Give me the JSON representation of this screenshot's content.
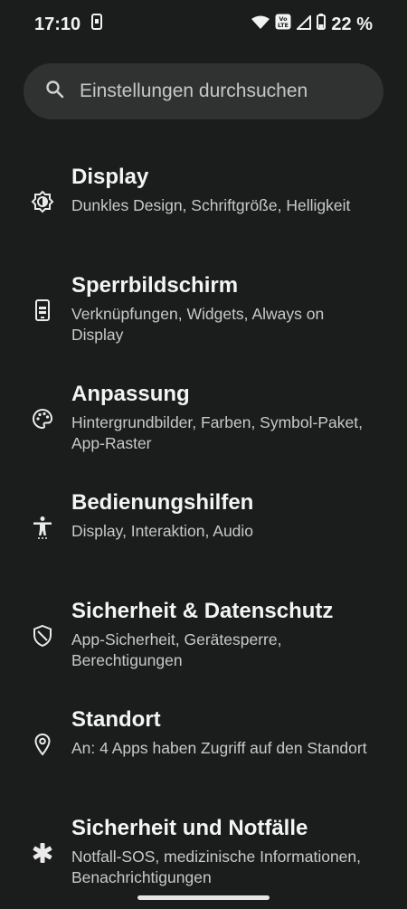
{
  "status": {
    "time": "17:10",
    "battery_text": "22 %",
    "volte": "Vo LTE"
  },
  "search": {
    "placeholder": "Einstellungen durchsuchen"
  },
  "items": [
    {
      "title": "Display",
      "subtitle": "Dunkles Design, Schriftgröße, Helligkeit",
      "icon": "display-icon"
    },
    {
      "title": "Sperrbildschirm",
      "subtitle": "Verknüpfungen, Widgets, Always on Display",
      "icon": "lockscreen-icon"
    },
    {
      "title": "Anpassung",
      "subtitle": "Hintergrundbilder, Farben, Symbol-Paket, App-Raster",
      "icon": "palette-icon"
    },
    {
      "title": "Bedienungshilfen",
      "subtitle": "Display, Interaktion, Audio",
      "icon": "accessibility-icon"
    },
    {
      "title": "Sicherheit & Datenschutz",
      "subtitle": "App-Sicherheit, Gerätesperre, Berechtigungen",
      "icon": "shield-icon"
    },
    {
      "title": "Standort",
      "subtitle": "An: 4 Apps haben Zugriff auf den Standort",
      "icon": "location-icon"
    },
    {
      "title": "Sicherheit und Notfälle",
      "subtitle": "Notfall-SOS, medizinische Informationen, Benachrichtigungen",
      "icon": "emergency-icon"
    }
  ]
}
